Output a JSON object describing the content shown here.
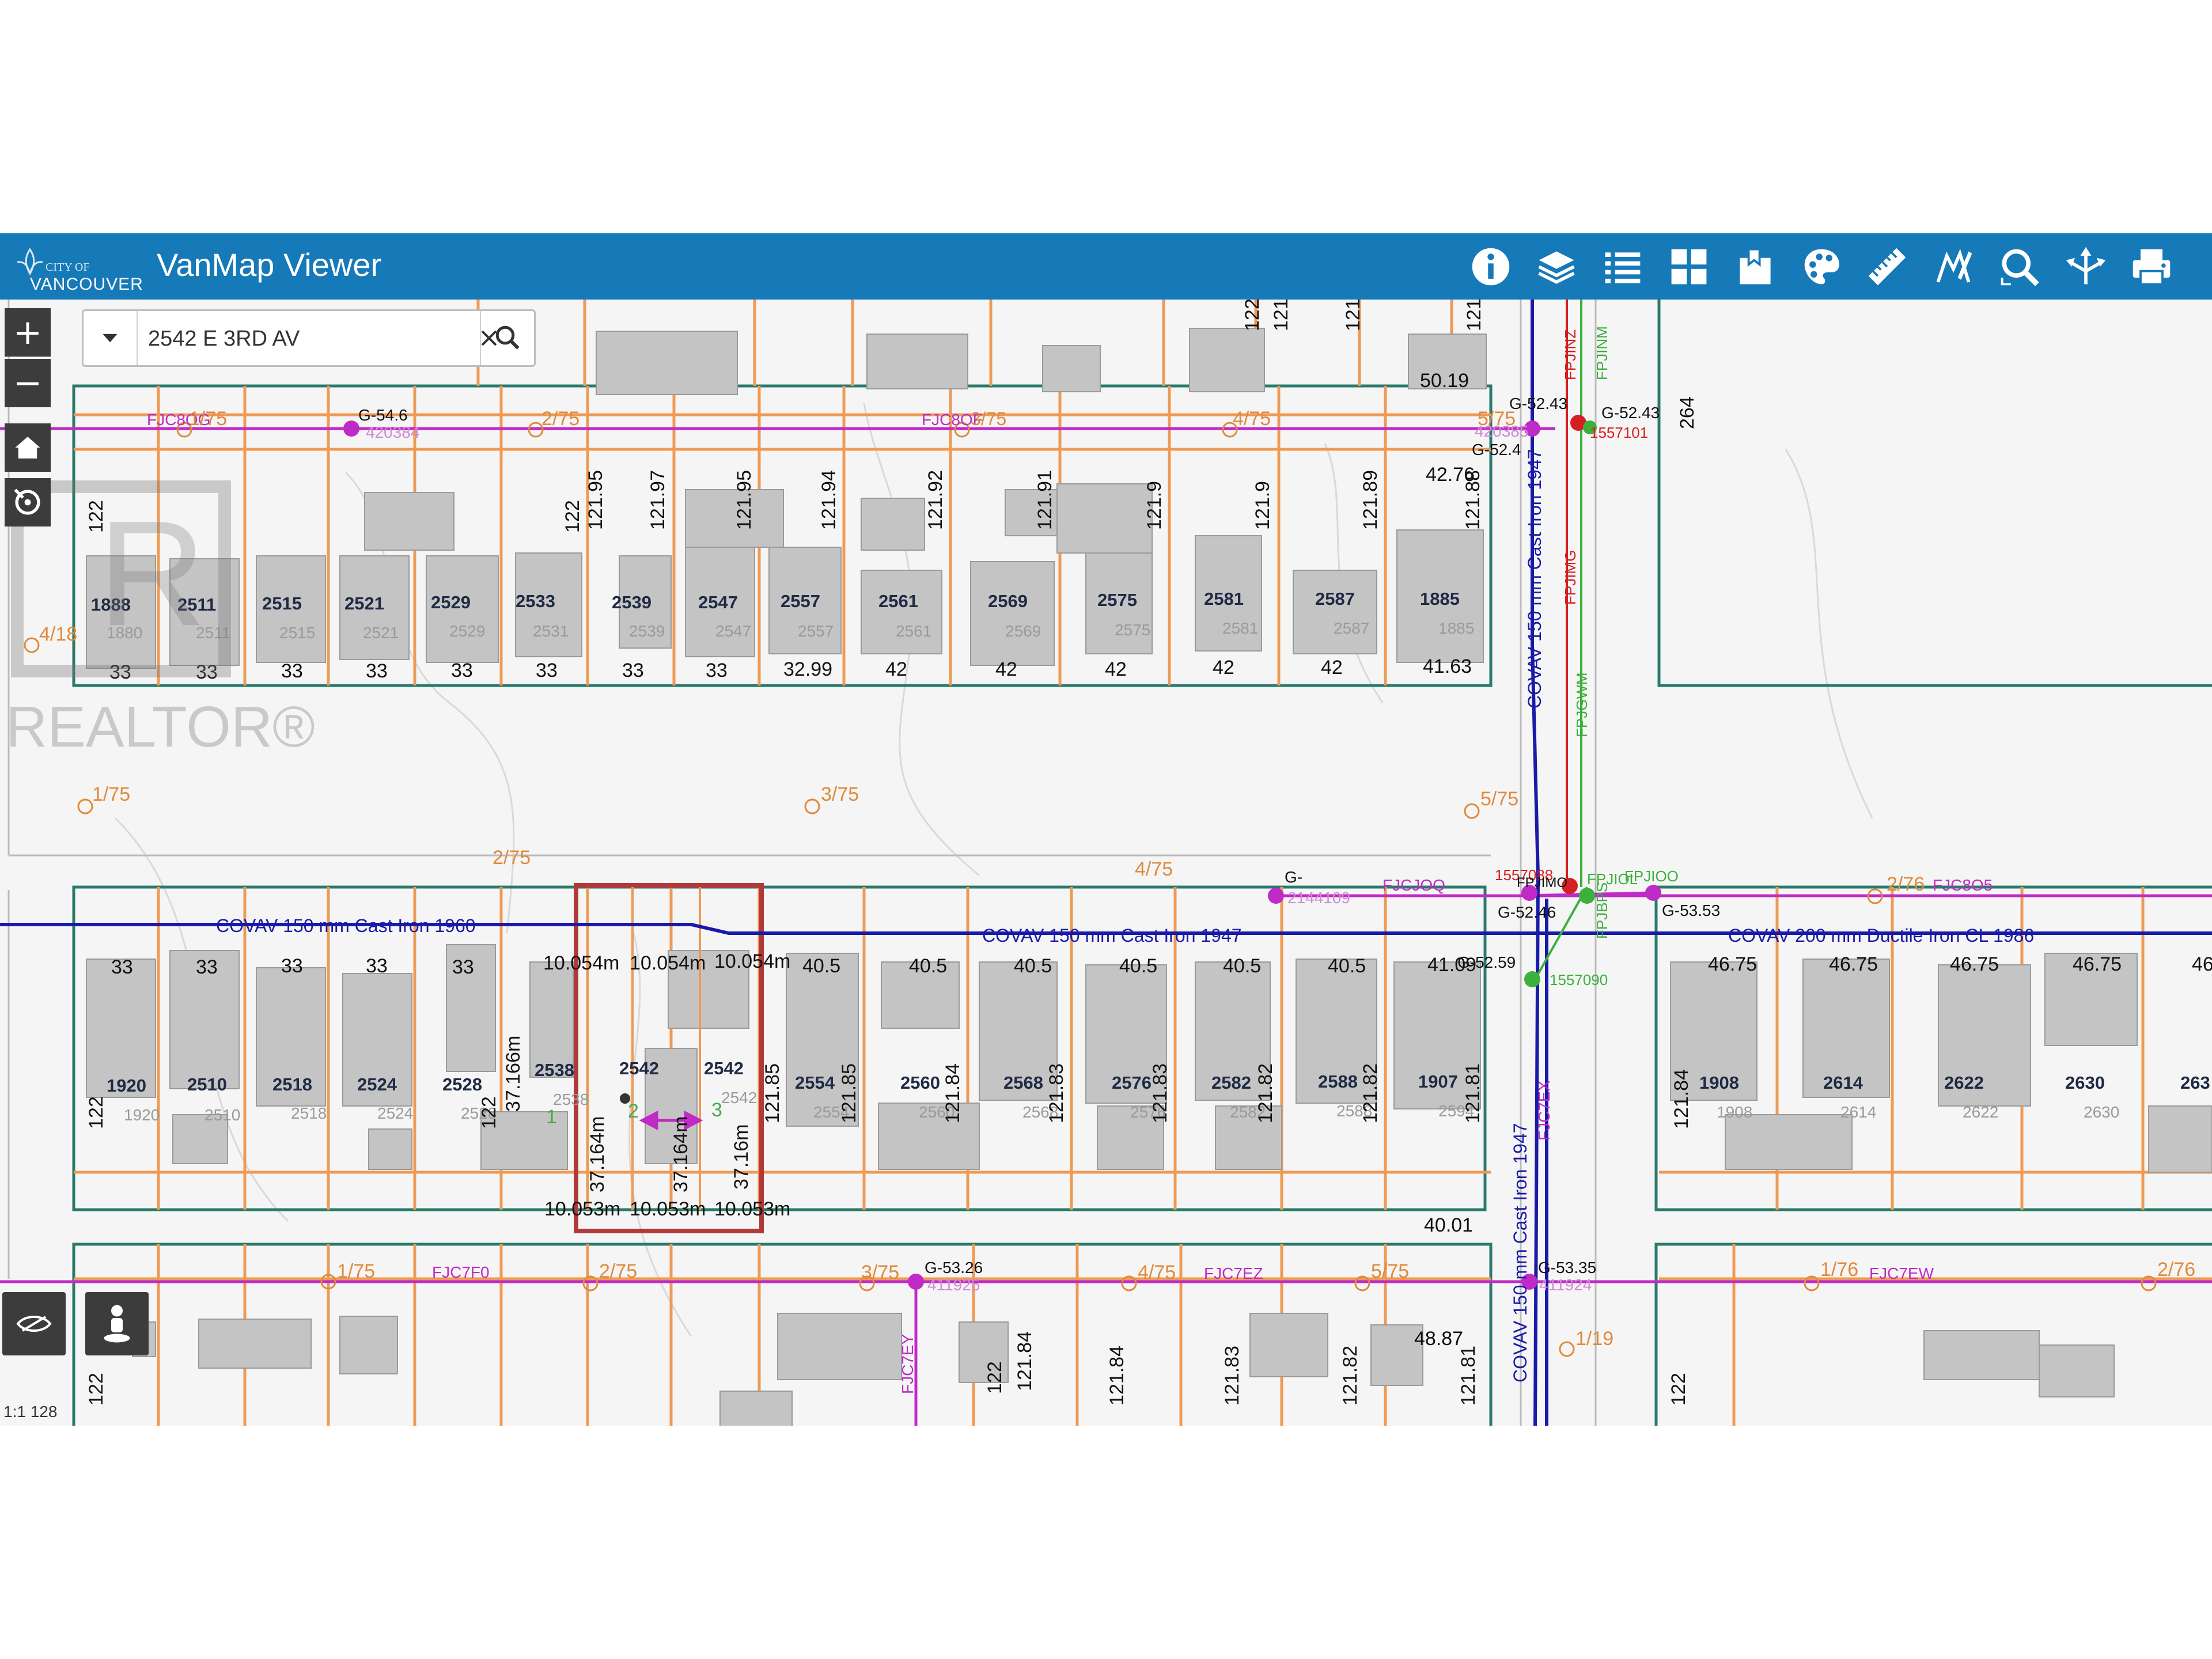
{
  "app": {
    "title": "VanMap Viewer",
    "logo_city": "CITY OF",
    "logo_name": "VANCOUVER",
    "watermark": "REALTOR®"
  },
  "search": {
    "value": "2542 E 3RD AV"
  },
  "toolbar": [
    {
      "name": "info-icon"
    },
    {
      "name": "layers-icon"
    },
    {
      "name": "legend-icon"
    },
    {
      "name": "basemap-gallery-icon"
    },
    {
      "name": "bookmark-icon"
    },
    {
      "name": "palette-icon"
    },
    {
      "name": "measure-ruler-icon"
    },
    {
      "name": "draw-icon"
    },
    {
      "name": "zoom-search-icon"
    },
    {
      "name": "share-icon"
    },
    {
      "name": "print-icon"
    }
  ],
  "map_controls": {
    "zoom_in": "+",
    "zoom_out": "−",
    "scale": "1:1 128"
  },
  "streets": {
    "main_north": "COVAV 150 mm Cast Iron   1960",
    "main_north_mid": "COVAV 150 mm Cast Iron   1947",
    "main_east": "COVAV 200 mm Ductile Iron CL 1986",
    "main_vertical": "COVAV 150 mm Cast Iron   1947",
    "main_vertical_south": "COVAV 150 mm Cast Iron   1947"
  },
  "lots_north": [
    {
      "num": "1888",
      "ghost": "1880",
      "width": "33"
    },
    {
      "num": "2511",
      "ghost": "2511",
      "width": "33"
    },
    {
      "num": "2515",
      "ghost": "2515",
      "width": "33"
    },
    {
      "num": "2521",
      "ghost": "2521",
      "width": "33"
    },
    {
      "num": "2529",
      "ghost": "2529",
      "width": "33"
    },
    {
      "num": "2533",
      "ghost": "2531",
      "width": "33"
    },
    {
      "num": "2539",
      "ghost": "2539",
      "width": "33"
    },
    {
      "num": "2547",
      "ghost": "2547",
      "width": "33"
    },
    {
      "num": "2557",
      "ghost": "2557",
      "width": "32.99"
    },
    {
      "num": "2561",
      "ghost": "2561",
      "width": "42"
    },
    {
      "num": "2569",
      "ghost": "2569",
      "width": "42"
    },
    {
      "num": "2575",
      "ghost": "2575",
      "width": "42"
    },
    {
      "num": "2581",
      "ghost": "2581",
      "width": "42"
    },
    {
      "num": "2587",
      "ghost": "2587",
      "width": "42"
    },
    {
      "num": "1885",
      "ghost": "1885",
      "width": "41.63"
    }
  ],
  "lots_north_depths": [
    "122",
    "122",
    "121.95",
    "121.97",
    "121.95",
    "121.94",
    "121.92",
    "121.91",
    "121.9",
    "121.9",
    "121.89",
    "121.88"
  ],
  "lots_north_extra": {
    "top_width": "50.19",
    "corner": "42.76"
  },
  "lots_south": [
    {
      "num": "1920",
      "ghost": "1920",
      "width": "33"
    },
    {
      "num": "2510",
      "ghost": "2510",
      "width": "33"
    },
    {
      "num": "2518",
      "ghost": "2518",
      "width": "33"
    },
    {
      "num": "2524",
      "ghost": "2524",
      "width": "33"
    },
    {
      "num": "2528",
      "ghost": "2528",
      "width": "33"
    },
    {
      "num": "2538",
      "ghost": "2538",
      "width": ""
    },
    {
      "num": "2542",
      "ghost": "",
      "width": ""
    },
    {
      "num": "2542",
      "ghost": "2542",
      "width": ""
    },
    {
      "num": "2554",
      "ghost": "2554",
      "width": "40.5"
    },
    {
      "num": "2560",
      "ghost": "2560",
      "width": "40.5"
    },
    {
      "num": "2568",
      "ghost": "2568",
      "width": "40.5"
    },
    {
      "num": "2576",
      "ghost": "2576",
      "width": "40.5"
    },
    {
      "num": "2582",
      "ghost": "2582",
      "width": "40.5"
    },
    {
      "num": "2588",
      "ghost": "2588",
      "width": "40.5"
    },
    {
      "num": "1907",
      "ghost": "2594",
      "width": "41.09"
    }
  ],
  "lots_south_depths": [
    "122",
    "122",
    "121.85",
    "121.85",
    "121.84",
    "121.83",
    "121.83",
    "121.82",
    "121.82",
    "121.81"
  ],
  "lots_south_extra": {
    "corner": "40.01",
    "dim_37a": "37.166m"
  },
  "lots_east": [
    {
      "num": "1908",
      "ghost": "1908",
      "width": "46.75"
    },
    {
      "num": "2614",
      "ghost": "2614",
      "width": "46.75"
    },
    {
      "num": "2622",
      "ghost": "2622",
      "width": "46.75"
    },
    {
      "num": "2630",
      "ghost": "2630",
      "width": "46.75"
    },
    {
      "num": "263",
      "ghost": "",
      "width": "46"
    }
  ],
  "lots_east_depth": "121.84",
  "subdivision": {
    "top_dims": [
      "10.054m",
      "10.054m",
      "10.054m"
    ],
    "bottom_dims": [
      "10.053m",
      "10.053m",
      "10.053m"
    ],
    "depths": [
      "37.164m",
      "37.164m",
      "37.16m"
    ],
    "part_labels": [
      "1",
      "2",
      "3"
    ]
  },
  "lots_bottom_depths": [
    "122",
    "122",
    "121.84",
    "121.84",
    "121.83",
    "121.82",
    "121.81",
    "122"
  ],
  "lots_bottom_extra": {
    "corner": "48.87"
  },
  "nodes": [
    {
      "id": "G-54.6",
      "sub": "420384"
    },
    {
      "id": "G-52.43",
      "sub": "420385"
    },
    {
      "id": "G-52.4",
      "sub": ""
    },
    {
      "id": "G-52.43",
      "sub": "1557101"
    },
    {
      "id": "G-",
      "sub": "2144109"
    },
    {
      "id": "G-52.46",
      "sub": "1557088"
    },
    {
      "id": "G-53.53",
      "sub": ""
    },
    {
      "id": "G-52.59",
      "sub": "1557090"
    },
    {
      "id": "G-53.26",
      "sub": "411925"
    },
    {
      "id": "G-53.35",
      "sub": "411924"
    }
  ],
  "codes": {
    "fjc8og": "FJC8OG",
    "fjc8of": "FJC8OF",
    "fjcjoq": "FJCJOQ",
    "fjc8o5": "FJC8O5",
    "fjc7f0": "FJC7F0",
    "fjc7ez": "FJC7EZ",
    "fjc7ew": "FJC7EW",
    "fjc7ey": "FJC7EY",
    "fjc7ex": "FJC7EX",
    "fpjinz": "FPJINZ",
    "fpjinm": "FPJINM",
    "fpjimg": "FPJIMG",
    "fpjgwm": "FPJGWM",
    "fpjioo": "FPJIOO",
    "fpjimo": "FPJIMO",
    "fpjiol": "FPJIOL",
    "fpjbps": "FPJBPS"
  },
  "ratios": [
    "1/75",
    "2/75",
    "3/75",
    "4/75",
    "5/75",
    "4/18",
    "1/75",
    "3/75",
    "2/75",
    "4/75",
    "5/75",
    "2/76",
    "1/75",
    "2/75",
    "3/75",
    "4/75",
    "5/75",
    "1/76",
    "2/76",
    "1/19"
  ],
  "misc_numbers": {
    "v264": "264",
    "v122a": "122",
    "v121a": "121",
    "v121b": "121",
    "v121c": "121",
    "v1": "1"
  },
  "colors": {
    "topbar": "#1679b8",
    "lot_line": "#ee9a55",
    "block_outline": "#2a7a6c",
    "water_main": "#1a1aa8",
    "gas": "#c02ac6",
    "hydrant": "#3cb03c",
    "valve": "#d42020",
    "selection": "#b03a3a"
  }
}
